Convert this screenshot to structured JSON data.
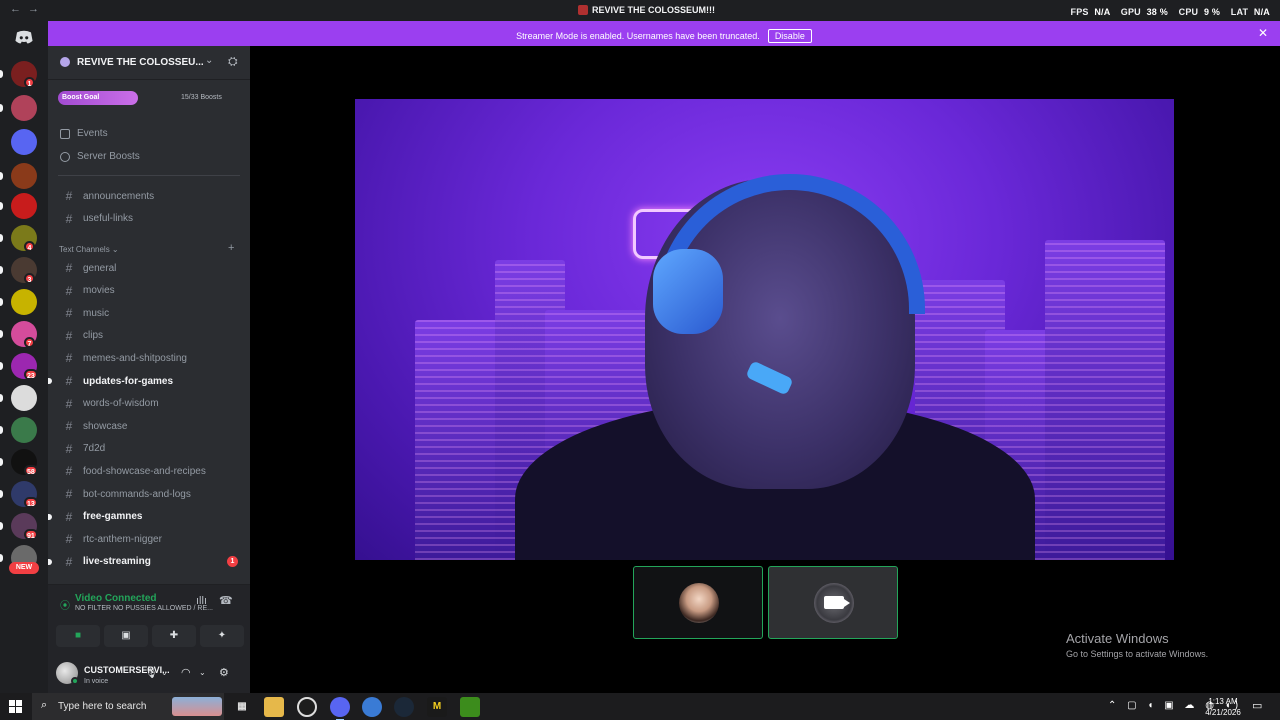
{
  "window": {
    "title": "REVIVE THE COLOSSEUM!!!",
    "overlay": {
      "fps_label": "FPS",
      "fps_value": "N/A",
      "gpu_label": "GPU",
      "gpu_value": "38 %",
      "cpu_label": "CPU",
      "cpu_value": "9 %",
      "lat_label": "LAT",
      "lat_value": "N/A"
    }
  },
  "banner": {
    "text": "Streamer Mode is enabled. Usernames have been truncated.",
    "button": "Disable"
  },
  "rail": {
    "servers": [
      {
        "color": "#7a1f1f",
        "badge": "1"
      },
      {
        "color": "#b0425a",
        "badge": ""
      },
      {
        "color": "#5865f2",
        "badge": ""
      },
      {
        "color": "#8a3a1a",
        "badge": ""
      },
      {
        "color": "#c81c1c",
        "badge": ""
      },
      {
        "color": "#7b7a1a",
        "badge": "4"
      },
      {
        "color": "#4a3a32",
        "badge": "3"
      },
      {
        "color": "#c7b300",
        "badge": ""
      },
      {
        "color": "#d44c9b",
        "badge": "7"
      },
      {
        "color": "#9c27b0",
        "badge": "23"
      },
      {
        "color": "#dcdcdc",
        "badge": ""
      },
      {
        "color": "#3a7a4a",
        "badge": ""
      },
      {
        "color": "#111111",
        "badge": "58"
      },
      {
        "color": "#2f3a6a",
        "badge": "13"
      },
      {
        "color": "#5a3a5a",
        "badge": "91"
      },
      {
        "color": "#6a6a6a",
        "badge": ""
      }
    ],
    "new_label": "NEW"
  },
  "sidebar": {
    "server_name": "REVIVE THE COLOSSEU...",
    "boost_goal": "Boost Goal",
    "boost_count": "15/33 Boosts",
    "events": "Events",
    "server_boosts": "Server Boosts",
    "top_channels": [
      {
        "name": "announcements",
        "unread": false
      },
      {
        "name": "useful-links",
        "unread": false
      }
    ],
    "category": "Text Channels",
    "channels": [
      {
        "name": "general",
        "unread": false,
        "badge": ""
      },
      {
        "name": "movies",
        "unread": false,
        "badge": ""
      },
      {
        "name": "music",
        "unread": false,
        "badge": ""
      },
      {
        "name": "clips",
        "unread": false,
        "badge": ""
      },
      {
        "name": "memes-and-shitposting",
        "unread": false,
        "badge": ""
      },
      {
        "name": "updates-for-games",
        "unread": true,
        "badge": ""
      },
      {
        "name": "words-of-wisdom",
        "unread": false,
        "badge": ""
      },
      {
        "name": "showcase",
        "unread": false,
        "badge": ""
      },
      {
        "name": "7d2d",
        "unread": false,
        "badge": ""
      },
      {
        "name": "food-showcase-and-recipes",
        "unread": false,
        "badge": ""
      },
      {
        "name": "bot-commands-and-logs",
        "unread": false,
        "badge": ""
      },
      {
        "name": "free-gamnes",
        "unread": true,
        "badge": ""
      },
      {
        "name": "rtc-anthem-nigger",
        "unread": false,
        "badge": ""
      },
      {
        "name": "live-streaming",
        "unread": true,
        "badge": "1"
      }
    ]
  },
  "voice": {
    "status": "Video Connected",
    "channel": "NO FILTER NO PUSSIES ALLOWED / RE..."
  },
  "user": {
    "name": "CUSTOMERSERVI...",
    "status": "In voice"
  },
  "watermark": {
    "title": "Activate Windows",
    "subtitle": "Go to Settings to activate Windows."
  },
  "taskbar": {
    "search_placeholder": "Type here to search",
    "time": "1:13 AM",
    "date": "4/21/2026"
  }
}
